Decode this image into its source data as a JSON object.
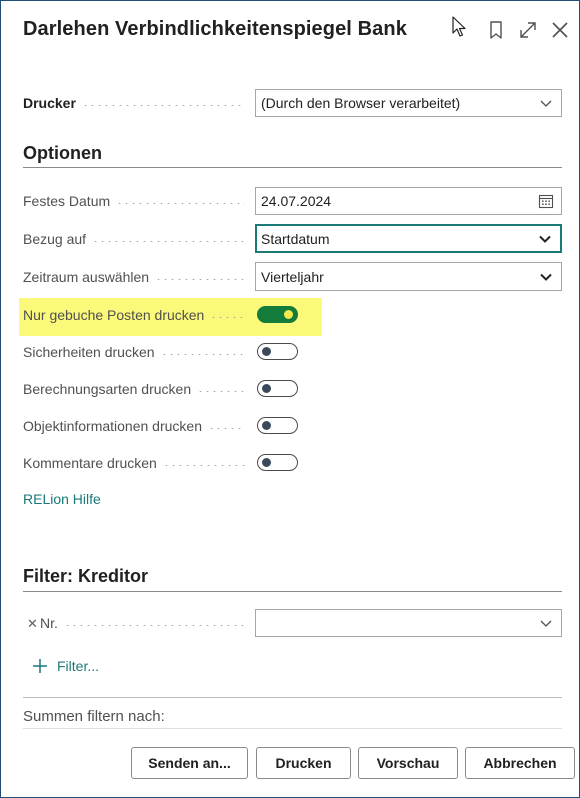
{
  "title": "Darlehen Verbindlichkeitenspiegel Bank",
  "header_icons": [
    "bookmark-icon",
    "expand-icon",
    "close-icon"
  ],
  "printer": {
    "label": "Drucker",
    "value": "(Durch den Browser verarbeitet)"
  },
  "options": {
    "title": "Optionen",
    "fixed_date": {
      "label": "Festes Datum",
      "value": "24.07.2024"
    },
    "reference": {
      "label": "Bezug auf",
      "value": "Startdatum"
    },
    "period": {
      "label": "Zeitraum auswählen",
      "value": "Vierteljahr"
    },
    "toggles": [
      {
        "label": "Nur gebuche Posten drucken",
        "on": true
      },
      {
        "label": "Sicherheiten drucken",
        "on": false
      },
      {
        "label": "Berechnungsarten drucken",
        "on": false
      },
      {
        "label": "Objektinformationen drucken",
        "on": false
      },
      {
        "label": "Kommentare drucken",
        "on": false
      }
    ],
    "help_link": "RELion Hilfe"
  },
  "filter": {
    "title": "Filter: Kreditor",
    "field_label": "Nr.",
    "field_value": "",
    "add_filter": "Filter...",
    "sum_filter_label": "Summen filtern nach:"
  },
  "buttons": {
    "send": "Senden an...",
    "print": "Drucken",
    "preview": "Vorschau",
    "cancel": "Abbrechen"
  },
  "colors": {
    "accent": "#1a7a78",
    "toggle_on": "#137c3b",
    "highlight": "#fbf97a"
  }
}
